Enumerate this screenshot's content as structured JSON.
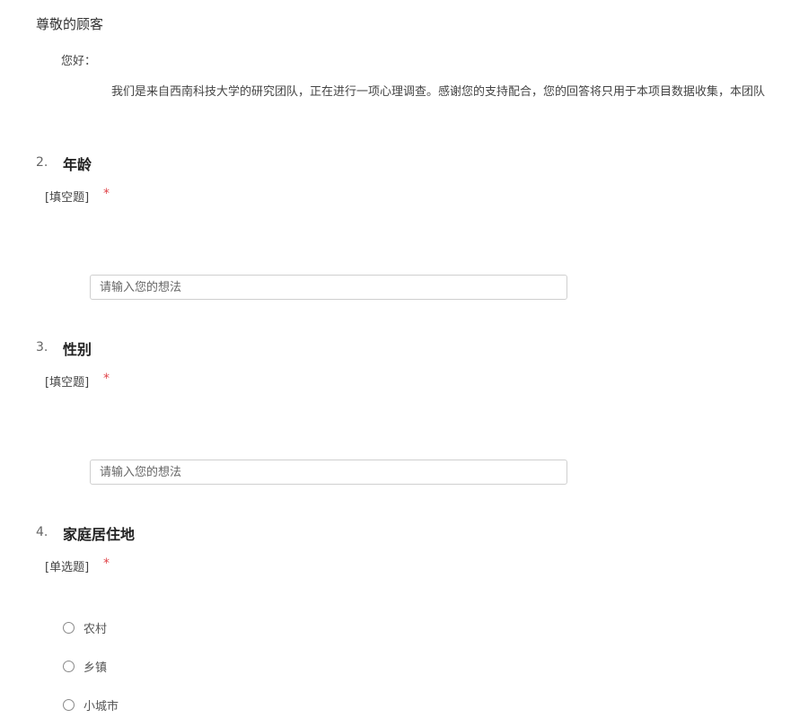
{
  "intro": {
    "greeting": "尊敬的顾客",
    "hello": "您好：",
    "text": "我们是来自西南科技大学的研究团队，正在进行一项心理调查。感谢您的支持配合，您的回答将只用于本项目数据收集，本团队"
  },
  "questions": [
    {
      "number": "2.",
      "title": "年龄",
      "type": "[填空题]",
      "required": "*",
      "placeholder": "请输入您的想法"
    },
    {
      "number": "3.",
      "title": "性别",
      "type": "[填空题]",
      "required": "*",
      "placeholder": "请输入您的想法"
    },
    {
      "number": "4.",
      "title": "家庭居住地",
      "type": "[单选题]",
      "required": "*",
      "options": [
        "农村",
        "乡镇",
        "小城市"
      ]
    }
  ],
  "colors": {
    "required": "#e0454a",
    "border": "#cfcfcf"
  }
}
